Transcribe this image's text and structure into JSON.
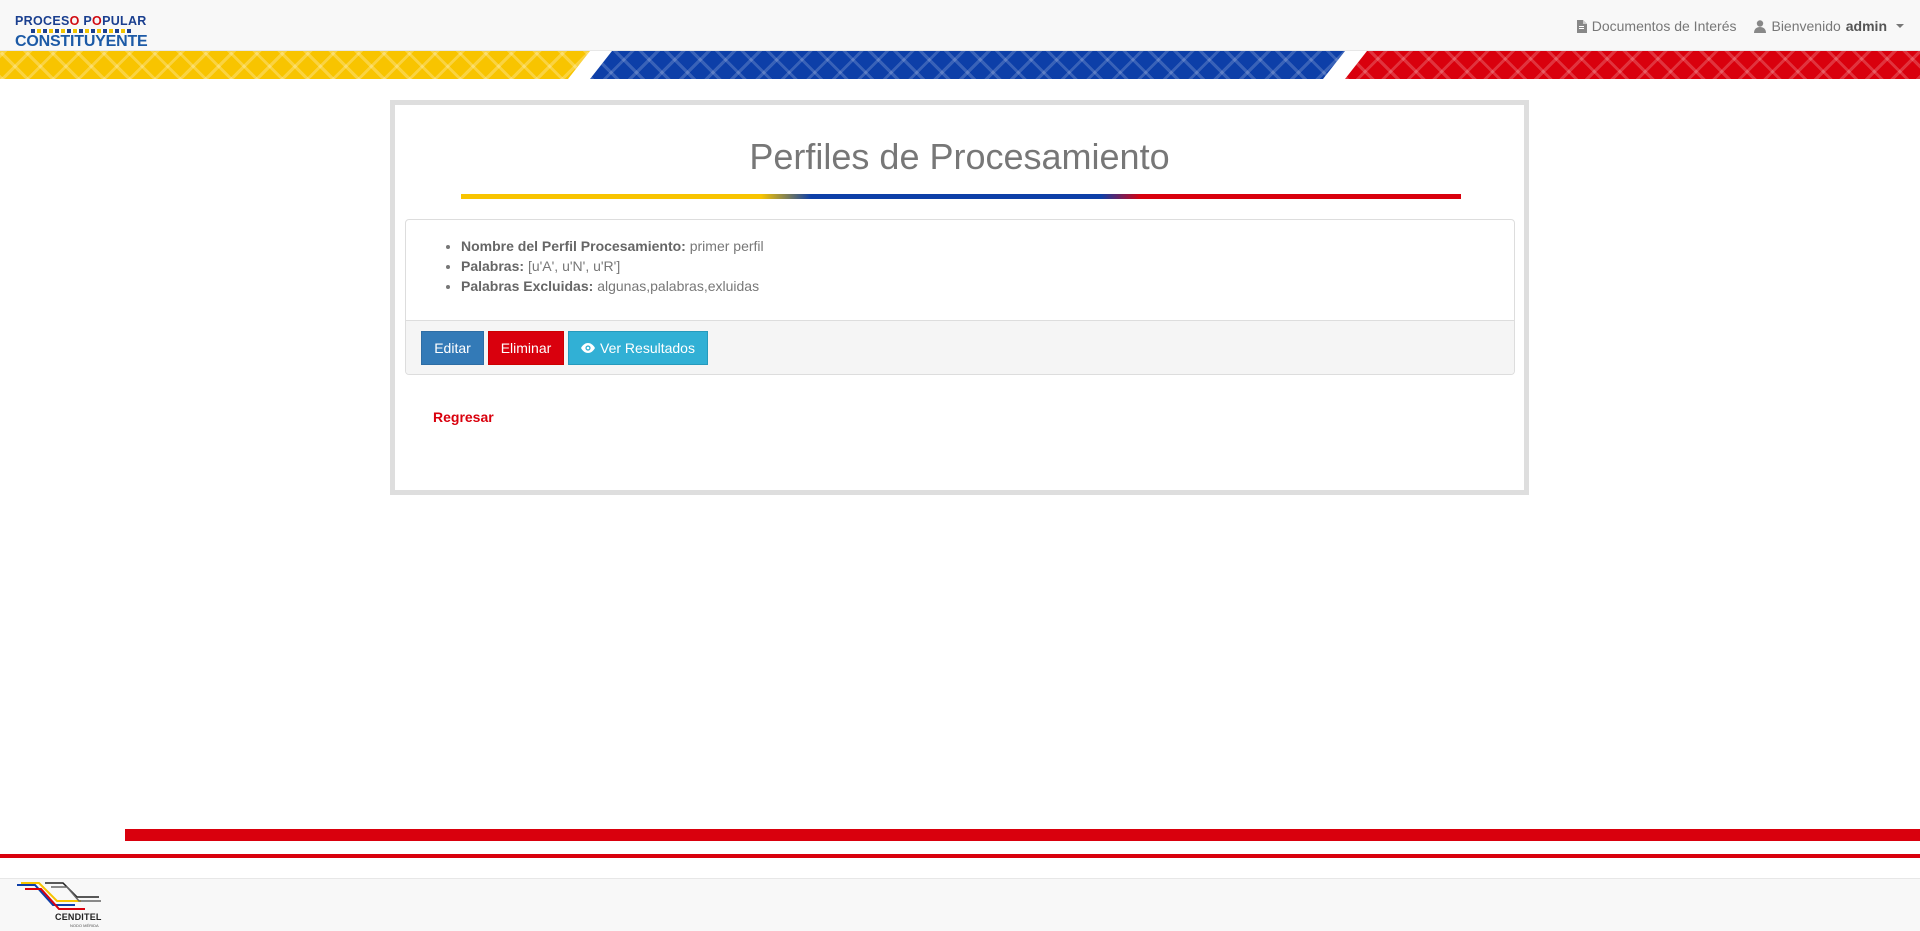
{
  "navbar": {
    "logo": {
      "line1_blue_a": "PROCES",
      "line1_red_a": "O",
      "line1_blue_b": " P",
      "line1_red_b": "O",
      "line1_blue_c": "PULAR",
      "line2": "CONSTITUYENTE"
    },
    "documents_label": "Documentos de Interés",
    "welcome_label": "Bienvenido",
    "username": "admin"
  },
  "main": {
    "title": "Perfiles de Procesamiento",
    "details": [
      {
        "label": "Nombre del Perfil Procesamiento:",
        "value": "primer perfil"
      },
      {
        "label": "Palabras:",
        "value": "[u'A', u'N', u'R']"
      },
      {
        "label": "Palabras Excluidas:",
        "value": "algunas,palabras,exluidas"
      }
    ],
    "buttons": {
      "edit": "Editar",
      "delete": "Eliminar",
      "view_results": "Ver Resultados"
    },
    "back_link": "Regresar"
  },
  "footer": {
    "logo_text": "CENDITEL",
    "logo_subtext": "NODO MÉRIDA"
  },
  "colors": {
    "yellow": "#f8c400",
    "blue": "#0d3fa8",
    "red": "#d9000d",
    "primary_button": "#337ab7",
    "info_button": "#31b0d5"
  }
}
